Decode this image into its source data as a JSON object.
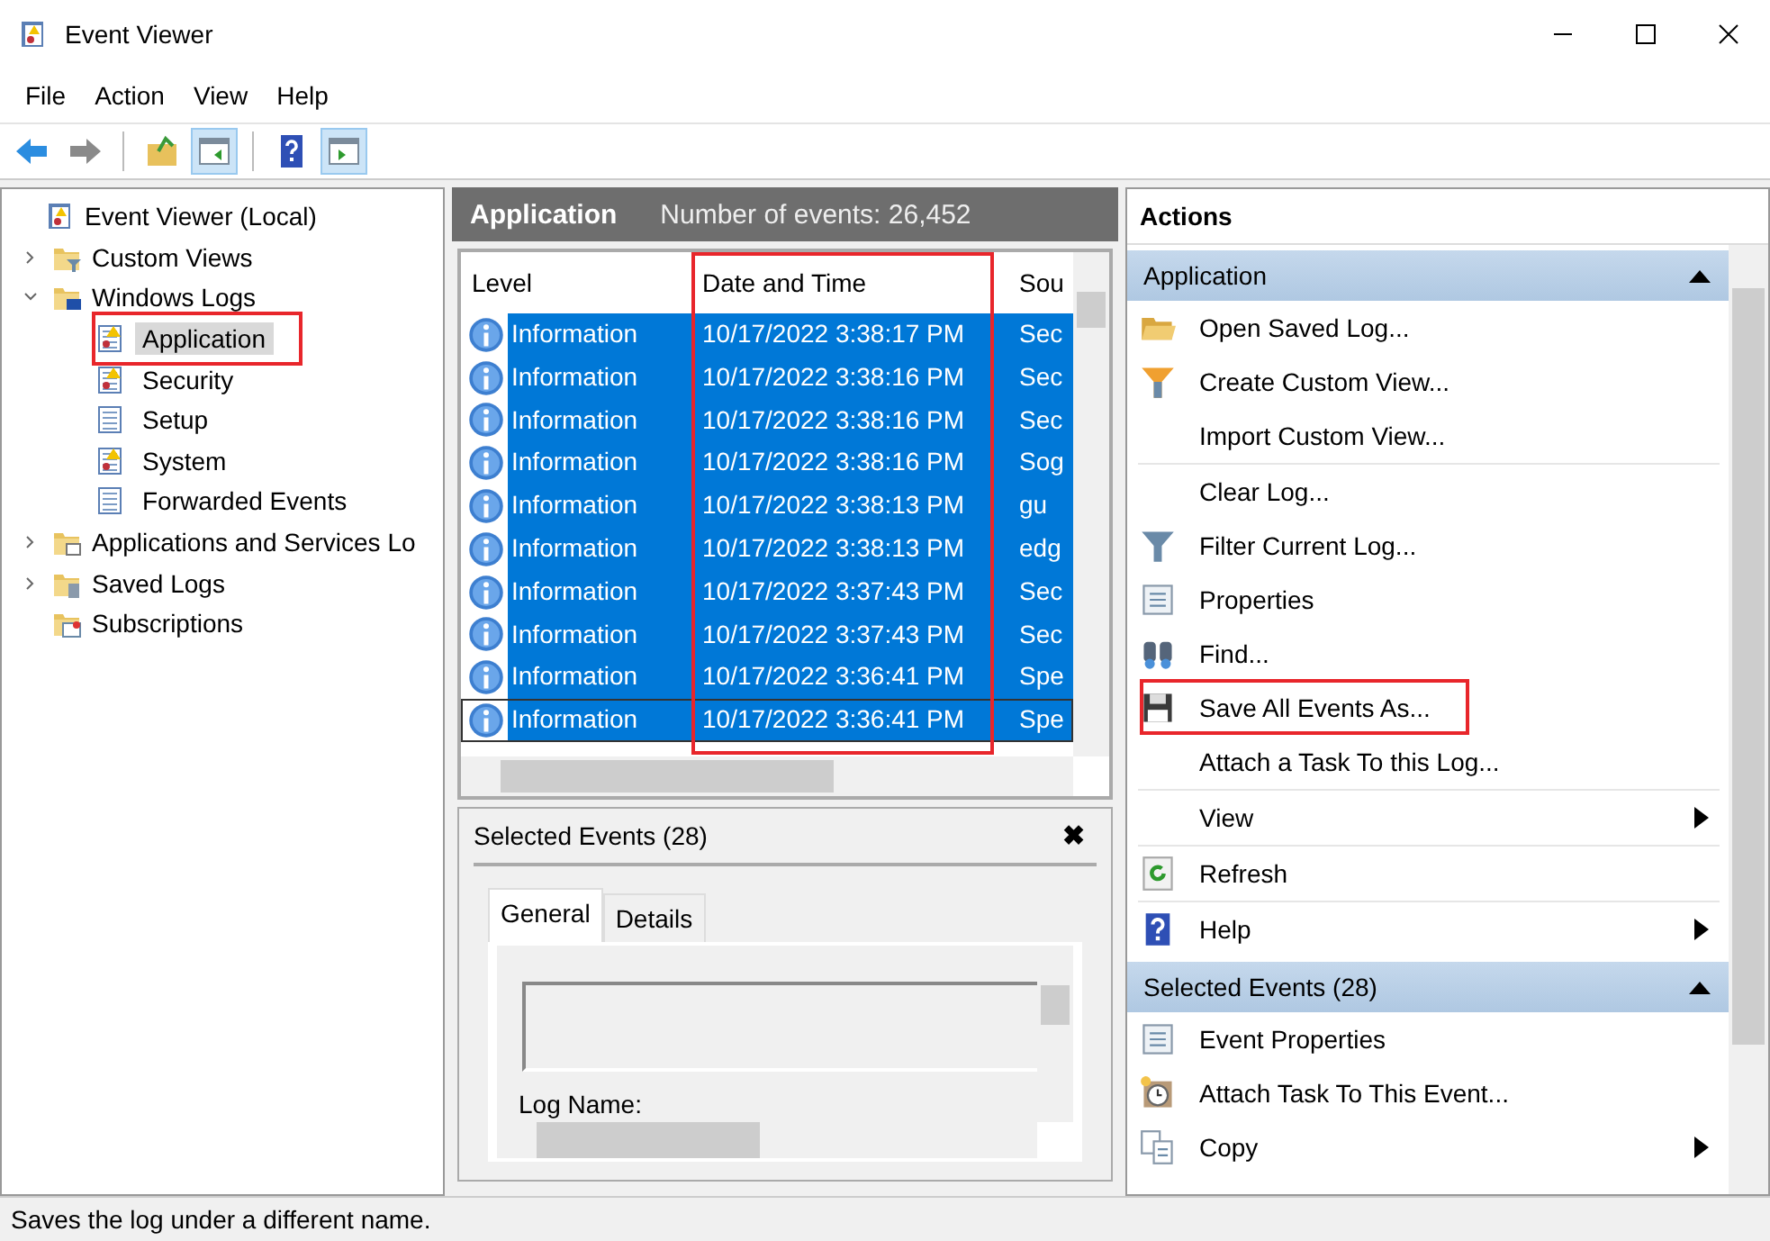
{
  "window": {
    "title": "Event Viewer"
  },
  "menu": [
    "File",
    "Action",
    "View",
    "Help"
  ],
  "toolbar": [
    {
      "pressed": false
    },
    {
      "pressed": false
    },
    {
      "pressed": false
    },
    {
      "pressed": true
    },
    {
      "pressed": false
    },
    {
      "pressed": true
    }
  ],
  "tree": [
    {
      "label": "Event Viewer (Local)",
      "children": [
        {
          "label": "Custom Views",
          "kind": "filter",
          "expanded": false
        },
        {
          "label": "Windows Logs",
          "kind": "computer",
          "expanded": true,
          "children": [
            {
              "label": "Application",
              "kind": "warning",
              "selected": true,
              "highlighted": true
            },
            {
              "label": "Security",
              "kind": "warning",
              "selected": false,
              "highlighted": false
            },
            {
              "label": "Setup",
              "kind": "plain",
              "selected": false,
              "highlighted": false
            },
            {
              "label": "System",
              "kind": "warning",
              "selected": false,
              "highlighted": false
            },
            {
              "label": "Forwarded Events",
              "kind": "plain",
              "selected": false,
              "highlighted": false
            }
          ]
        },
        {
          "label": "Applications and Services Lo",
          "kind": "window",
          "expanded": false
        },
        {
          "label": "Saved Logs",
          "kind": "saved",
          "expanded": false
        },
        {
          "label": "Subscriptions",
          "kind": "subscriptions"
        }
      ]
    }
  ],
  "log_header": {
    "title": "Application",
    "count": "Number of events: 26,452"
  },
  "table": {
    "columns": [
      {
        "label": "Level",
        "highlighted": false
      },
      {
        "label": "Date and Time",
        "highlighted": true
      },
      {
        "label": "Sou",
        "highlighted": false
      }
    ],
    "rows": [
      {
        "level": "Information",
        "date": "10/17/2022 3:38:17 PM",
        "source": "Sec",
        "selected": true,
        "focused": false
      },
      {
        "level": "Information",
        "date": "10/17/2022 3:38:16 PM",
        "source": "Sec",
        "selected": true,
        "focused": false
      },
      {
        "level": "Information",
        "date": "10/17/2022 3:38:16 PM",
        "source": "Sec",
        "selected": true,
        "focused": false
      },
      {
        "level": "Information",
        "date": "10/17/2022 3:38:16 PM",
        "source": "Sog",
        "selected": true,
        "focused": false
      },
      {
        "level": "Information",
        "date": "10/17/2022 3:38:13 PM",
        "source": "gu",
        "selected": true,
        "focused": false
      },
      {
        "level": "Information",
        "date": "10/17/2022 3:38:13 PM",
        "source": "edg",
        "selected": true,
        "focused": false
      },
      {
        "level": "Information",
        "date": "10/17/2022 3:37:43 PM",
        "source": "Sec",
        "selected": true,
        "focused": false
      },
      {
        "level": "Information",
        "date": "10/17/2022 3:37:43 PM",
        "source": "Sec",
        "selected": true,
        "focused": false
      },
      {
        "level": "Information",
        "date": "10/17/2022 3:36:41 PM",
        "source": "Spe",
        "selected": true,
        "focused": false
      },
      {
        "level": "Information",
        "date": "10/17/2022 3:36:41 PM",
        "source": "Spe",
        "selected": true,
        "focused": true
      }
    ]
  },
  "details": {
    "title": "Selected Events (28)",
    "close": "✖",
    "tabs": [
      {
        "label": "General",
        "selected": true
      },
      {
        "label": "Details",
        "selected": false
      }
    ],
    "field_label": "Log Name:"
  },
  "actions": {
    "title": "Actions",
    "groups": [
      {
        "title": "Application",
        "expanded": true,
        "items": [
          {
            "label": "Open Saved Log...",
            "kind": "folder",
            "submenu": false,
            "separator_before": false,
            "highlighted": false
          },
          {
            "label": "Create Custom View...",
            "kind": "funnel-color",
            "submenu": false,
            "separator_before": false,
            "highlighted": false
          },
          {
            "label": "Import Custom View...",
            "kind": "plain",
            "submenu": false,
            "separator_before": false,
            "highlighted": false
          },
          {
            "label": "Clear Log...",
            "kind": "plain",
            "submenu": false,
            "separator_before": true,
            "highlighted": false
          },
          {
            "label": "Filter Current Log...",
            "kind": "funnel",
            "submenu": false,
            "separator_before": false,
            "highlighted": false
          },
          {
            "label": "Properties",
            "kind": "properties",
            "submenu": false,
            "separator_before": false,
            "highlighted": false
          },
          {
            "label": "Find...",
            "kind": "binoculars",
            "submenu": false,
            "separator_before": false,
            "highlighted": false
          },
          {
            "label": "Save All Events As...",
            "kind": "floppy",
            "submenu": false,
            "separator_before": false,
            "highlighted": true
          },
          {
            "label": "Attach a Task To this Log...",
            "kind": "plain",
            "submenu": false,
            "separator_before": false,
            "highlighted": false
          },
          {
            "label": "View",
            "kind": "plain",
            "submenu": true,
            "separator_before": true,
            "highlighted": false
          },
          {
            "label": "Refresh",
            "kind": "refresh",
            "submenu": false,
            "separator_before": true,
            "highlighted": false
          },
          {
            "label": "Help",
            "kind": "help",
            "submenu": true,
            "separator_before": true,
            "highlighted": false
          }
        ]
      },
      {
        "title": "Selected Events (28)",
        "expanded": true,
        "items": [
          {
            "label": "Event Properties",
            "kind": "properties",
            "submenu": false,
            "separator_before": false,
            "highlighted": false
          },
          {
            "label": "Attach Task To This Event...",
            "kind": "clock",
            "submenu": false,
            "separator_before": false,
            "highlighted": false
          },
          {
            "label": "Copy",
            "kind": "copy",
            "submenu": true,
            "separator_before": false,
            "highlighted": false
          }
        ]
      }
    ]
  },
  "status_bar": "Saves the log under a different name."
}
